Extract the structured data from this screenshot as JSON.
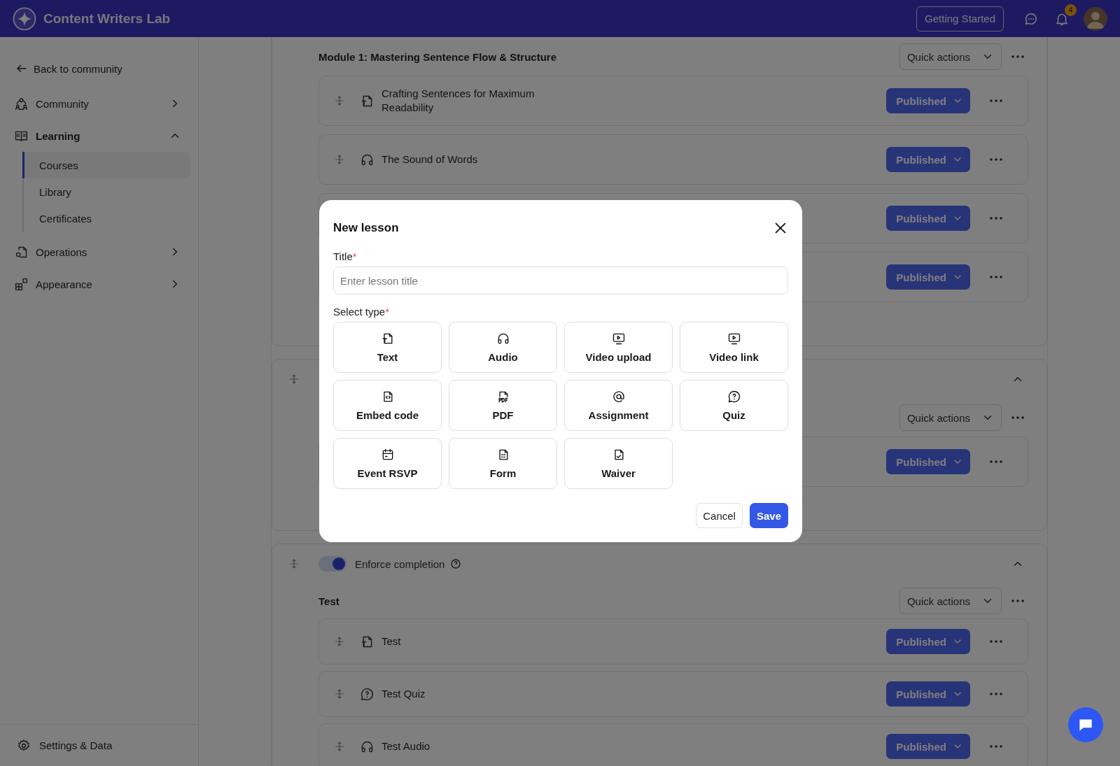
{
  "top_bar": {
    "app_name": "Content Writers Lab",
    "getting_started": "Getting Started",
    "notification_count": "4"
  },
  "sidebar": {
    "back_link": "Back to community",
    "items": [
      {
        "label": "Community",
        "kind": "community",
        "expanded": false
      },
      {
        "label": "Learning",
        "kind": "learning",
        "expanded": true,
        "children": [
          {
            "label": "Courses",
            "selected": true
          },
          {
            "label": "Library",
            "selected": false
          },
          {
            "label": "Certificates",
            "selected": false
          }
        ]
      },
      {
        "label": "Operations",
        "kind": "operations",
        "expanded": false
      },
      {
        "label": "Appearance",
        "kind": "appearance",
        "expanded": false
      }
    ],
    "footer": "Settings & Data"
  },
  "sections": [
    {
      "title": "Module 1: Mastering Sentence Flow & Structure",
      "quick_actions": "Quick actions",
      "lessons": [
        {
          "title": "Crafting Sentences for Maximum Readability",
          "kind": "text",
          "status": "Published"
        },
        {
          "title": "The Sound of Words",
          "kind": "audio",
          "status": "Published"
        },
        {
          "status": "Published"
        },
        {
          "status": "Published"
        }
      ]
    },
    {
      "expanded": true,
      "quick_actions": "Quick actions",
      "lessons": [
        {
          "status": "Published"
        }
      ]
    },
    {
      "expanded": true,
      "enforce_completion": {
        "label": "Enforce completion",
        "on": true
      },
      "title": "Test",
      "quick_actions": "Quick actions",
      "lessons": [
        {
          "title": "Test",
          "kind": "text",
          "status": "Published"
        },
        {
          "title": "Test Quiz",
          "kind": "quiz",
          "status": "Published"
        },
        {
          "title": "Test Audio",
          "kind": "audio",
          "status": "Published"
        }
      ]
    }
  ],
  "modal": {
    "title": "New lesson",
    "title_field": {
      "label": "Title",
      "required_mark": "*",
      "placeholder": "Enter lesson title"
    },
    "type_label": "Select type",
    "type_required_mark": "*",
    "types": [
      {
        "label": "Text",
        "kind": "text"
      },
      {
        "label": "Audio",
        "kind": "audio"
      },
      {
        "label": "Video upload",
        "kind": "video"
      },
      {
        "label": "Video link",
        "kind": "video"
      },
      {
        "label": "Embed code",
        "kind": "embed"
      },
      {
        "label": "PDF",
        "kind": "pdf"
      },
      {
        "label": "Assignment",
        "kind": "assignment"
      },
      {
        "label": "Quiz",
        "kind": "quiz"
      },
      {
        "label": "Event RSVP",
        "kind": "event"
      },
      {
        "label": "Form",
        "kind": "form"
      },
      {
        "label": "Waiver",
        "kind": "waiver"
      }
    ],
    "cancel": "Cancel",
    "save": "Save"
  }
}
